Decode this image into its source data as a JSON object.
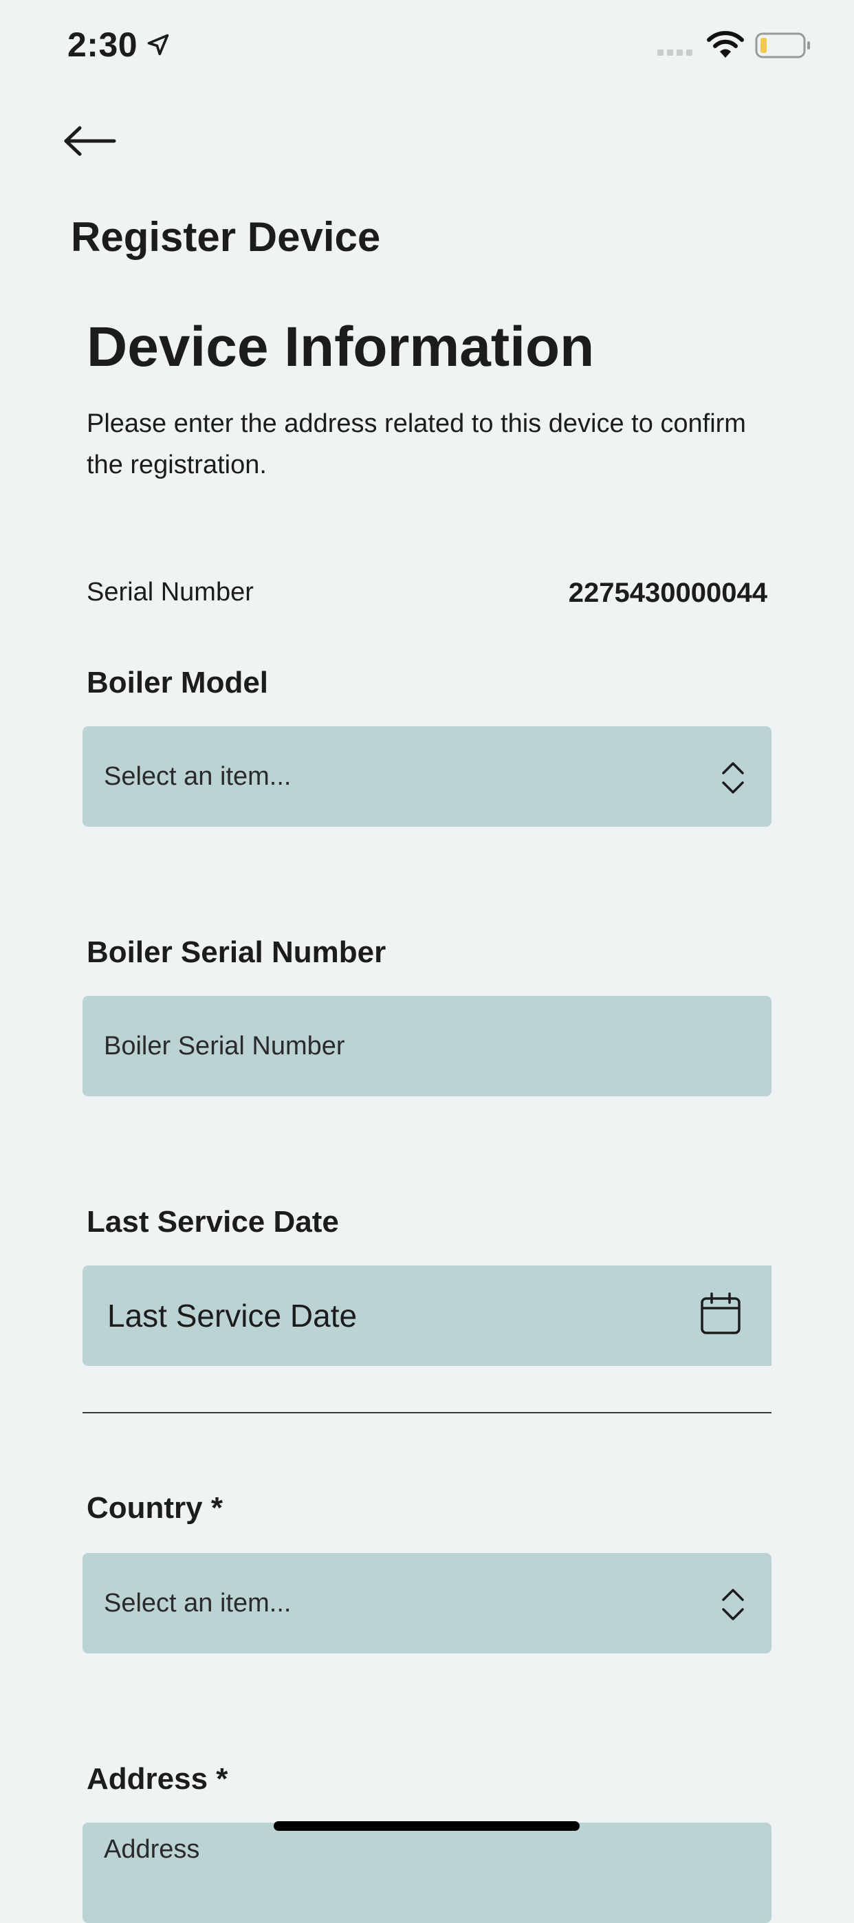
{
  "status_bar": {
    "time": "2:30"
  },
  "header": {
    "title": "Register Device"
  },
  "section": {
    "title": "Device Information",
    "description": "Please enter the address related to this device to confirm the registration."
  },
  "serial": {
    "label": "Serial Number",
    "value": "2275430000044"
  },
  "fields": {
    "boiler_model": {
      "label": "Boiler Model",
      "placeholder": "Select an item..."
    },
    "boiler_serial": {
      "label": "Boiler Serial Number",
      "placeholder": "Boiler Serial Number"
    },
    "last_service": {
      "label": "Last Service Date",
      "placeholder": "Last Service Date"
    },
    "country": {
      "label": "Country *",
      "placeholder": "Select an item..."
    },
    "address": {
      "label": "Address *",
      "placeholder": "Address"
    }
  },
  "icons": {
    "back": "arrow-left-icon",
    "location": "location-arrow-icon",
    "wifi": "wifi-icon",
    "battery": "battery-icon",
    "chevron": "chevron-up-down-icon",
    "calendar": "calendar-icon"
  },
  "colors": {
    "background": "#eff3f3",
    "field_fill": "#bcd3d4",
    "battery_level": "#f2c94c"
  }
}
